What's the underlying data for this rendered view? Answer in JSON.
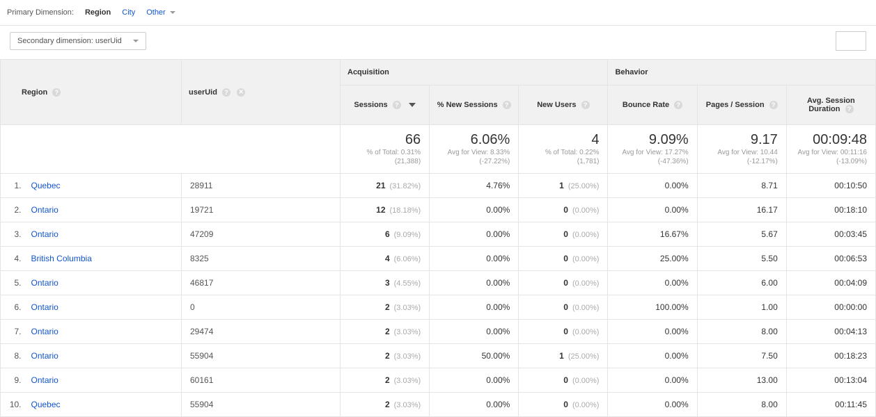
{
  "primaryDimension": {
    "label": "Primary Dimension:",
    "tabs": [
      "Region",
      "City",
      "Other"
    ],
    "active": "Region"
  },
  "secondaryDimension": {
    "label": "Secondary dimension: userUid"
  },
  "columns": {
    "region": "Region",
    "userUid": "userUid",
    "acquisition": "Acquisition",
    "behavior": "Behavior",
    "sessions": "Sessions",
    "pctNew": "% New Sessions",
    "newUsers": "New Users",
    "bounce": "Bounce Rate",
    "pages": "Pages / Session",
    "duration": "Avg. Session Duration"
  },
  "summary": {
    "sessions": {
      "big": "66",
      "sub1": "% of Total: 0.31%",
      "sub2": "(21,388)"
    },
    "pctNew": {
      "big": "6.06%",
      "sub1": "Avg for View: 8.33%",
      "sub2": "(-27.22%)"
    },
    "newUsers": {
      "big": "4",
      "sub1": "% of Total: 0.22%",
      "sub2": "(1,781)"
    },
    "bounce": {
      "big": "9.09%",
      "sub1": "Avg for View: 17.27%",
      "sub2": "(-47.36%)"
    },
    "pages": {
      "big": "9.17",
      "sub1": "Avg for View: 10.44",
      "sub2": "(-12.17%)"
    },
    "duration": {
      "big": "00:09:48",
      "sub1": "Avg for View: 00:11:16",
      "sub2": "(-13.09%)"
    }
  },
  "rows": [
    {
      "idx": "1.",
      "region": "Quebec",
      "uid": "28911",
      "sessions": "21",
      "sessionsPct": "(31.82%)",
      "pctNew": "4.76%",
      "newUsers": "1",
      "newUsersPct": "(25.00%)",
      "bounce": "0.00%",
      "pages": "8.71",
      "duration": "00:10:50"
    },
    {
      "idx": "2.",
      "region": "Ontario",
      "uid": "19721",
      "sessions": "12",
      "sessionsPct": "(18.18%)",
      "pctNew": "0.00%",
      "newUsers": "0",
      "newUsersPct": "(0.00%)",
      "bounce": "0.00%",
      "pages": "16.17",
      "duration": "00:18:10"
    },
    {
      "idx": "3.",
      "region": "Ontario",
      "uid": "47209",
      "sessions": "6",
      "sessionsPct": "(9.09%)",
      "pctNew": "0.00%",
      "newUsers": "0",
      "newUsersPct": "(0.00%)",
      "bounce": "16.67%",
      "pages": "5.67",
      "duration": "00:03:45"
    },
    {
      "idx": "4.",
      "region": "British Columbia",
      "uid": "8325",
      "sessions": "4",
      "sessionsPct": "(6.06%)",
      "pctNew": "0.00%",
      "newUsers": "0",
      "newUsersPct": "(0.00%)",
      "bounce": "25.00%",
      "pages": "5.50",
      "duration": "00:06:53"
    },
    {
      "idx": "5.",
      "region": "Ontario",
      "uid": "46817",
      "sessions": "3",
      "sessionsPct": "(4.55%)",
      "pctNew": "0.00%",
      "newUsers": "0",
      "newUsersPct": "(0.00%)",
      "bounce": "0.00%",
      "pages": "6.00",
      "duration": "00:04:09"
    },
    {
      "idx": "6.",
      "region": "Ontario",
      "uid": "0",
      "sessions": "2",
      "sessionsPct": "(3.03%)",
      "pctNew": "0.00%",
      "newUsers": "0",
      "newUsersPct": "(0.00%)",
      "bounce": "100.00%",
      "pages": "1.00",
      "duration": "00:00:00"
    },
    {
      "idx": "7.",
      "region": "Ontario",
      "uid": "29474",
      "sessions": "2",
      "sessionsPct": "(3.03%)",
      "pctNew": "0.00%",
      "newUsers": "0",
      "newUsersPct": "(0.00%)",
      "bounce": "0.00%",
      "pages": "8.00",
      "duration": "00:04:13"
    },
    {
      "idx": "8.",
      "region": "Ontario",
      "uid": "55904",
      "sessions": "2",
      "sessionsPct": "(3.03%)",
      "pctNew": "50.00%",
      "newUsers": "1",
      "newUsersPct": "(25.00%)",
      "bounce": "0.00%",
      "pages": "7.50",
      "duration": "00:18:23"
    },
    {
      "idx": "9.",
      "region": "Ontario",
      "uid": "60161",
      "sessions": "2",
      "sessionsPct": "(3.03%)",
      "pctNew": "0.00%",
      "newUsers": "0",
      "newUsersPct": "(0.00%)",
      "bounce": "0.00%",
      "pages": "13.00",
      "duration": "00:13:04"
    },
    {
      "idx": "10.",
      "region": "Quebec",
      "uid": "55904",
      "sessions": "2",
      "sessionsPct": "(3.03%)",
      "pctNew": "0.00%",
      "newUsers": "0",
      "newUsersPct": "(0.00%)",
      "bounce": "0.00%",
      "pages": "8.00",
      "duration": "00:11:45"
    }
  ]
}
